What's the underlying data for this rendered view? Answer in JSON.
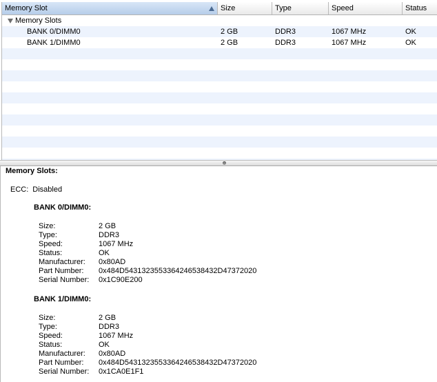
{
  "table": {
    "columns": [
      {
        "label": "Memory Slot",
        "sorted": true
      },
      {
        "label": "Size"
      },
      {
        "label": "Type"
      },
      {
        "label": "Speed"
      },
      {
        "label": "Status"
      }
    ],
    "group": {
      "label": "Memory Slots"
    },
    "rows": [
      {
        "slot": "BANK 0/DIMM0",
        "size": "2 GB",
        "type": "DDR3",
        "speed": "1067 MHz",
        "status": "OK"
      },
      {
        "slot": "BANK 1/DIMM0",
        "size": "2 GB",
        "type": "DDR3",
        "speed": "1067 MHz",
        "status": "OK"
      }
    ]
  },
  "detail": {
    "title": "Memory Slots:",
    "ecc_label": "ECC:",
    "ecc_value": "Disabled",
    "banks": [
      {
        "title": "BANK 0/DIMM0:",
        "props": [
          {
            "k": "Size:",
            "v": "2 GB"
          },
          {
            "k": "Type:",
            "v": "DDR3"
          },
          {
            "k": "Speed:",
            "v": "1067 MHz"
          },
          {
            "k": "Status:",
            "v": "OK"
          },
          {
            "k": "Manufacturer:",
            "v": "0x80AD"
          },
          {
            "k": "Part Number:",
            "v": "0x484D5431323553364246538432D47372020"
          },
          {
            "k": "Serial Number:",
            "v": "0x1C90E200"
          }
        ]
      },
      {
        "title": "BANK 1/DIMM0:",
        "props": [
          {
            "k": "Size:",
            "v": "2 GB"
          },
          {
            "k": "Type:",
            "v": "DDR3"
          },
          {
            "k": "Speed:",
            "v": "1067 MHz"
          },
          {
            "k": "Status:",
            "v": "OK"
          },
          {
            "k": "Manufacturer:",
            "v": "0x80AD"
          },
          {
            "k": "Part Number:",
            "v": "0x484D5431323553364246538432D47372020"
          },
          {
            "k": "Serial Number:",
            "v": "0x1CA0E1F1"
          }
        ]
      }
    ]
  },
  "colors": {
    "stripe": "#edf3fd",
    "sorted_header": "#c6d9f0"
  }
}
